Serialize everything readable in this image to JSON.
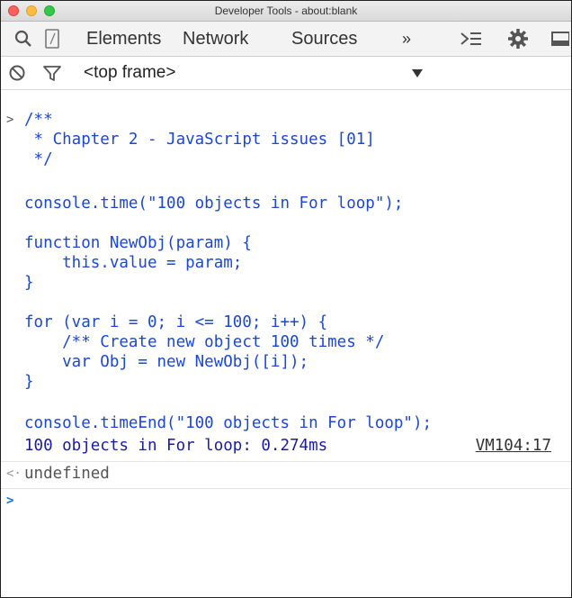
{
  "window": {
    "title": "Developer Tools - about:blank"
  },
  "toolbar": {
    "tabs": [
      "Elements",
      "Network",
      "Sources"
    ],
    "overflow": "»"
  },
  "filterbar": {
    "frame_selector": "<top frame>"
  },
  "console": {
    "input_prompt": ">",
    "code_lines": [
      "/**",
      " * Chapter 2 - JavaScript issues [01]",
      " */",
      "",
      "console.time(\"100 objects in For loop\");",
      "",
      "function NewObj(param) {",
      "    this.value = param;",
      "}",
      "",
      "for (var i = 0; i <= 100; i++) {",
      "    /** Create new object 100 times */",
      "    var Obj = new NewObj([i]);",
      "}",
      "",
      "console.timeEnd(\"100 objects in For loop\");"
    ],
    "log_output": "100 objects in For loop: 0.274ms",
    "log_source": "VM104:17",
    "result_prompt": "<·",
    "result_value": "undefined",
    "next_prompt": ">"
  },
  "colors": {
    "code": "#1a47d8",
    "log_text": "#1a1aa8",
    "result_text": "#555555"
  }
}
